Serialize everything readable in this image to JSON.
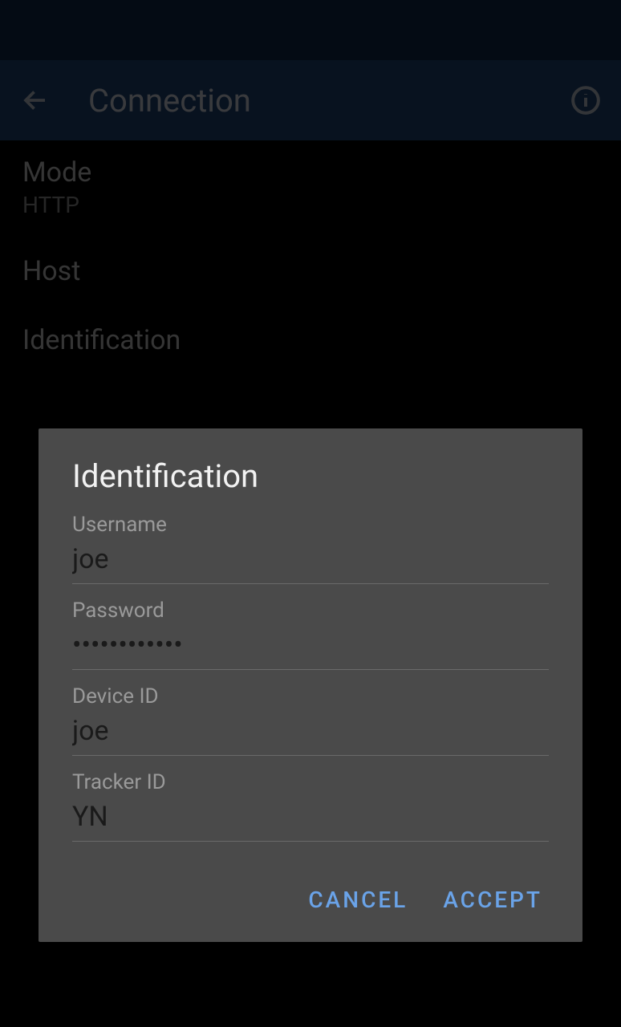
{
  "appbar": {
    "title": "Connection"
  },
  "settings": {
    "mode": {
      "label": "Mode",
      "value": "HTTP"
    },
    "host": {
      "label": "Host",
      "value": ""
    },
    "identification": {
      "label": "Identification",
      "value": ""
    }
  },
  "dialog": {
    "title": "Identification",
    "fields": {
      "username": {
        "label": "Username",
        "value": "joe"
      },
      "password": {
        "label": "Password",
        "value": "••••••••••••"
      },
      "deviceId": {
        "label": "Device ID",
        "value": "joe"
      },
      "trackerId": {
        "label": "Tracker ID",
        "value": "YN"
      }
    },
    "buttons": {
      "cancel": "CANCEL",
      "accept": "ACCEPT"
    }
  }
}
